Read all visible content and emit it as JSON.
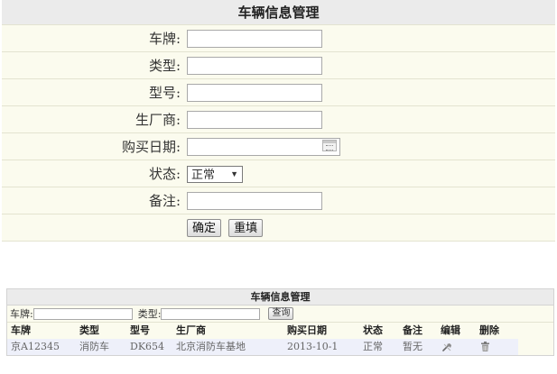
{
  "form": {
    "title": "车辆信息管理",
    "plate_label": "车牌:",
    "type_label": "类型:",
    "model_label": "型号:",
    "maker_label": "生厂商:",
    "date_label": "购买日期:",
    "status_label": "状态:",
    "status_value": "正常",
    "remark_label": "备注:",
    "confirm_button": "确定",
    "reset_button": "重填"
  },
  "list": {
    "title": "车辆信息管理",
    "search": {
      "plate_label": "车牌:",
      "type_label": "类型:",
      "query_button": "查询"
    },
    "columns": [
      "车牌",
      "类型",
      "型号",
      "生厂商",
      "购买日期",
      "状态",
      "备注",
      "编辑",
      "删除"
    ],
    "rows": [
      {
        "plate": "京A12345",
        "type": "消防车",
        "model": "DK654",
        "maker": "北京消防车基地",
        "date": "2013-10-1",
        "status": "正常",
        "remark": "暂无"
      }
    ]
  },
  "icons": {
    "date_picker": "calendar-icon",
    "status_dropdown": "chevron-down-icon",
    "edit": "edit-icon",
    "delete": "trash-icon"
  }
}
